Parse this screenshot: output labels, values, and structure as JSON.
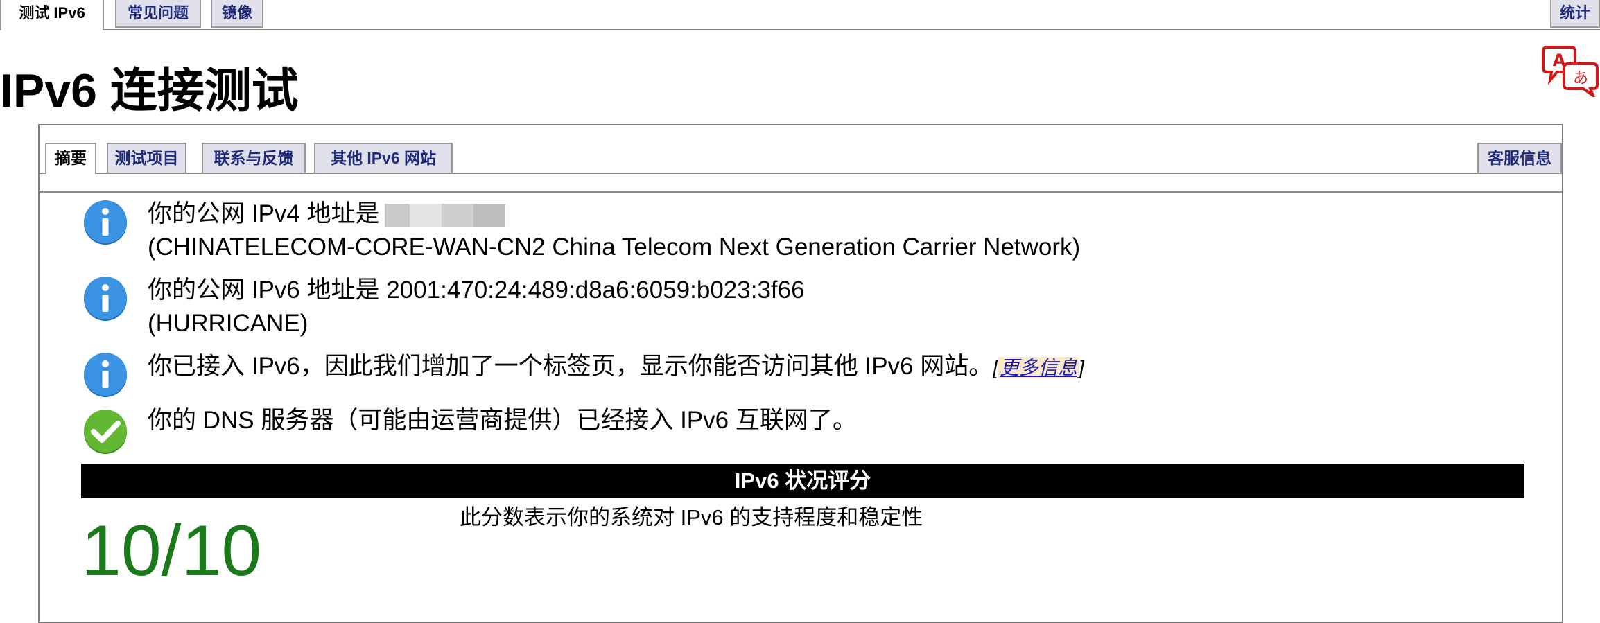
{
  "top_tabs": {
    "test_ipv6": "测试 IPv6",
    "faq": "常见问题",
    "mirrors": "镜像",
    "stats": "统计"
  },
  "page_title": "IPv6 连接测试",
  "translate_icon": "translate-icon",
  "inner_tabs": {
    "summary": "摘要",
    "tests": "测试项目",
    "contact": "联系与反馈",
    "other_sites": "其他 IPv6 网站",
    "helpdesk": "客服信息"
  },
  "results": {
    "ipv4_prefix": "你的公网 IPv4 地址是",
    "ipv4_isp": "(CHINATELECOM-CORE-WAN-CN2 China Telecom Next Generation Carrier Network)",
    "ipv6_prefix": "你的公网 IPv6 地址是",
    "ipv6_address": "2001:470:24:489:d8a6:6059:b023:3f66",
    "ipv6_isp": "(HURRICANE)",
    "tab_notice": "你已接入 IPv6，因此我们增加了一个标签页，显示你能否访问其他 IPv6 网站。",
    "more_info_open": "[",
    "more_info_link": "更多信息",
    "more_info_close": "]",
    "dns_ok": "你的 DNS 服务器（可能由运营商提供）已经接入 IPv6 互联网了。"
  },
  "score": {
    "header": "IPv6 状况评分",
    "value": "10/10",
    "description": "此分数表示你的系统对 IPv6 的支持程度和稳定性"
  },
  "colors": {
    "tab_bg": "#dfe0ea",
    "tab_text": "#1f2a7a",
    "info_blue": "#2f8ee0",
    "ok_green": "#5cb82e",
    "score_green": "#1a7a1a"
  }
}
